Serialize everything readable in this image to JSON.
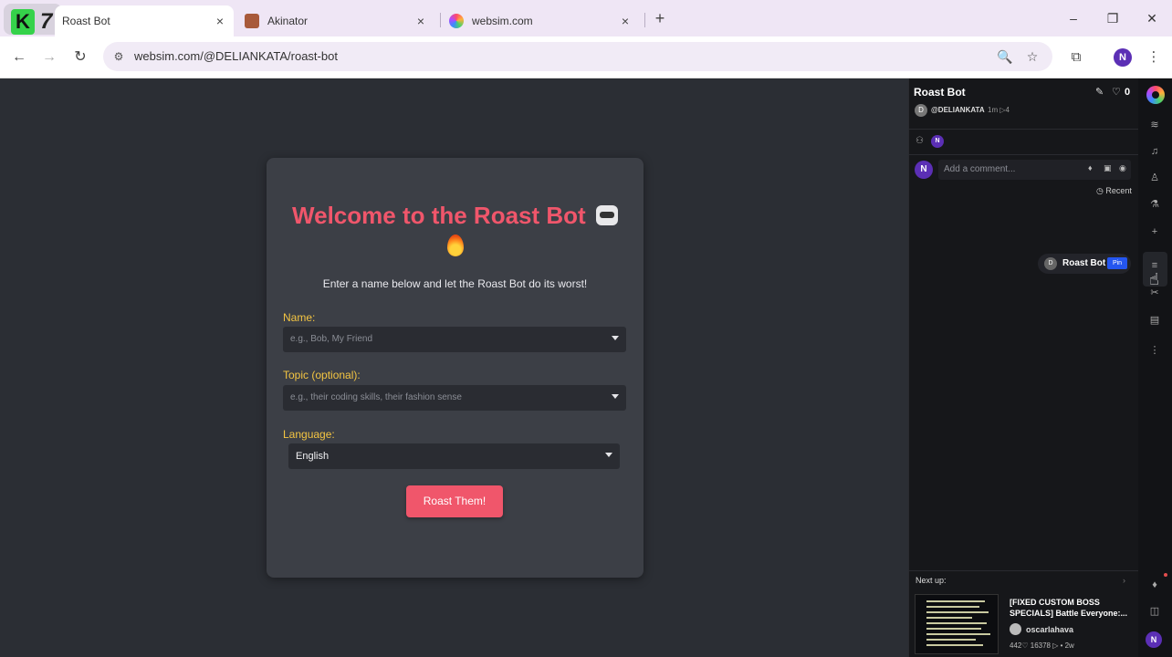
{
  "browser": {
    "tabs": [
      {
        "title": "Roast Bot",
        "active": true
      },
      {
        "title": "Akinator",
        "active": false
      },
      {
        "title": "websim.com",
        "active": false
      }
    ],
    "url": "websim.com/@DELIANKATA/roast-bot",
    "profile_initial": "N"
  },
  "icons": {
    "close": "×",
    "new_tab": "+",
    "minimize": "–",
    "restore": "❐",
    "window_close": "✕",
    "back": "←",
    "forward": "→",
    "reload": "↻",
    "site_info": "⚙",
    "zoom": "🔍",
    "star": "☆",
    "extensions": "⧉",
    "menu": "⋮"
  },
  "page": {
    "heading": "Welcome to the Roast Bot",
    "subtitle": "Enter a name below and let the Roast Bot do its worst!",
    "name_label": "Name:",
    "name_placeholder": "e.g., Bob, My Friend",
    "topic_label": "Topic (optional):",
    "topic_placeholder": "e.g., their coding skills, their fashion sense",
    "language_label": "Language:",
    "language_value": "English",
    "submit_label": "Roast Them!"
  },
  "panel": {
    "title": "Roast Bot",
    "like_count": "0",
    "author_initial": "D",
    "author": "@DELIANKATA",
    "meta": "1m  ▷4",
    "viewer_initial": "N",
    "comment_initial": "N",
    "comment_placeholder": "Add a comment...",
    "sort_label": "Recent",
    "pinned_initial": "D",
    "pinned_name": "Roast Bot",
    "pin_label": "Pin",
    "next_label": "Next up:",
    "next_title": "[FIXED CUSTOM BOSS SPECIALS] Battle Everyone:...",
    "next_author": "oscarlahava",
    "next_stats": "442♡  16378 ▷  •  2w"
  },
  "rail": {
    "profile_initial": "N"
  },
  "colors": {
    "accent": "#f0566b",
    "label": "#f4c542",
    "profile": "#5b2fb5",
    "pin_blue": "#2456f0"
  }
}
